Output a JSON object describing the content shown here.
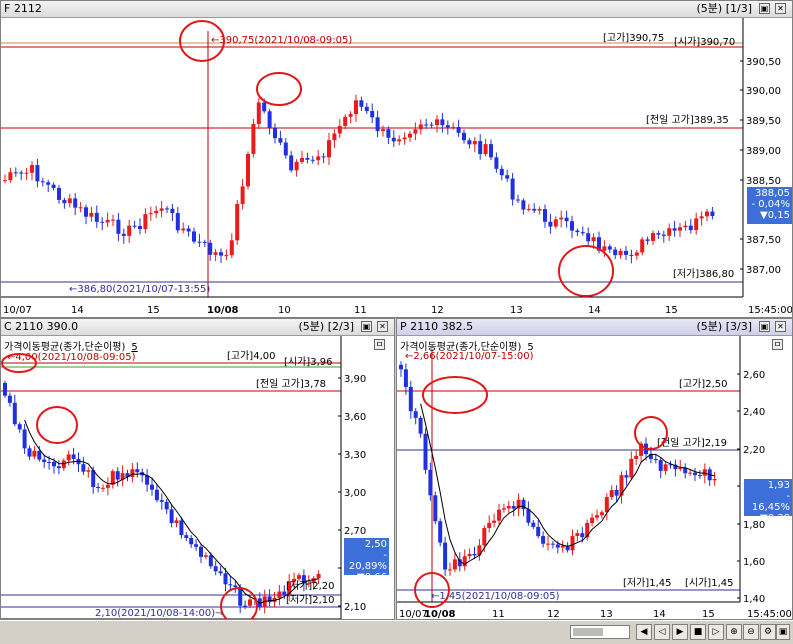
{
  "panels": {
    "f": {
      "title": "F 2112",
      "page": "(5분) [1/3]",
      "ylabels": [
        "390,50",
        "390,00",
        "389,50",
        "389,00",
        "388,50",
        "387,50",
        "387,00"
      ],
      "xlabels": [
        "10/07",
        "14",
        "15",
        "10/08",
        "10",
        "11",
        "12",
        "13",
        "14",
        "15",
        "15:45:00"
      ],
      "annot_high": "390,75(2021/10/08-09:05)",
      "annot_low": "386,80(2021/10/07-13:55)",
      "ref_high": "[고가]390,75",
      "ref_open": "[시가]390,70",
      "ref_prev_high": "[전일 고가]389,35",
      "ref_low": "[저가]386,80",
      "price_box": [
        "388,05",
        "- 0,04%",
        "▼0,15"
      ]
    },
    "c": {
      "title": "C 2110 390.0",
      "page": "(5분) [2/3]",
      "legend": "가격이동평균(종가,단순이평)",
      "legend_n": "5",
      "ylabels": [
        "3,90",
        "3,60",
        "3,30",
        "3,00",
        "2,70",
        "2,40",
        "2,10"
      ],
      "xlabels": [
        "10/07",
        "10",
        "11",
        "12",
        "13",
        "14",
        "15",
        "15:45:00"
      ],
      "annot_high": "4,00(2021/10/08-09:05)",
      "annot_low": "2,10(2021/10/08-14:00)",
      "ref_high": "[고가]4,00",
      "ref_open": "[시가]3,96",
      "ref_prev_high": "[전일 고가]3,78",
      "ref_low_a": "[저가]2,20",
      "ref_low_b": "[저가]2,10",
      "price_box": [
        "2,50",
        "- 20,89%",
        "▼0,66"
      ]
    },
    "p": {
      "title": "P 2110 382.5",
      "page": "(5분) [3/3]",
      "legend": "가격이동평균(종가,단순이평)",
      "legend_n": "5",
      "ylabels": [
        "2,60",
        "2,40",
        "2,20",
        "2,00",
        "1,80",
        "1,60",
        "1,40"
      ],
      "xlabels": [
        "10/07",
        "10/08",
        "11",
        "12",
        "13",
        "14",
        "15",
        "15:45:00"
      ],
      "annot_high": "2,66(2021/10/07-15:00)",
      "annot_low": "1,45(2021/10/08-09:05)",
      "ref_high": "[고가]2,50",
      "ref_prev_high": "[전일 고가]2,19",
      "ref_low": "[저가]1,45",
      "ref_open": "[시가]1,45",
      "price_box": [
        "1,93",
        "- 16,45%",
        "▼0,38"
      ]
    }
  },
  "colors": {
    "up": "#e81c1c",
    "down": "#2030e0",
    "ma": "#000000",
    "ref_red": "#c00000",
    "ref_blue": "#303090",
    "box": "#3d6fd8"
  },
  "icons": [
    "close-icon",
    "zoom-in-icon",
    "zoom-out-icon",
    "play-icon",
    "stop-icon",
    "rewind-icon"
  ]
}
